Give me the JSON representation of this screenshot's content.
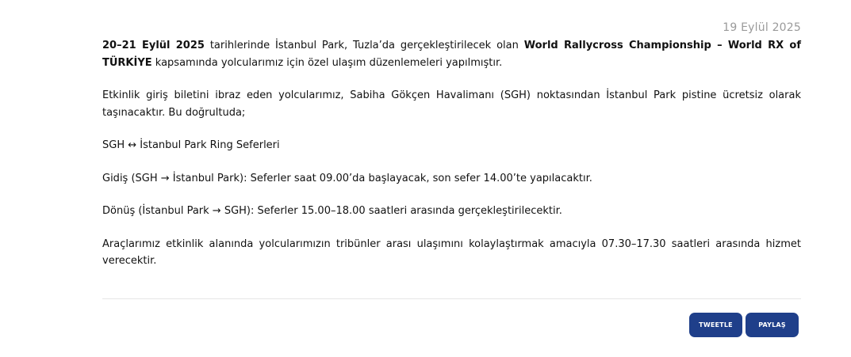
{
  "article": {
    "date": "19 Eylül 2025",
    "p1": {
      "date_range": "20–21 Eylül 2025",
      "text_a": " tarihlerinde İstanbul Park, Tuzla’da gerçekleştirilecek olan ",
      "event_name": "World Rallycross Championship – World RX of TÜRKİYE",
      "text_b": " kapsamında yolcularımız için özel ulaşım düzenlemeleri yapılmıştır."
    },
    "p2": "Etkinlik giriş biletini ibraz eden yolcularımız, Sabiha Gökçen Havalimanı (SGH) noktasından İstanbul Park pistine ücretsiz olarak taşınacaktır. Bu doğrultuda;",
    "p3": "SGH ↔ İstanbul Park Ring Seferleri",
    "p4": "Gidiş (SGH → İstanbul Park): Seferler saat 09.00’da başlayacak, son sefer 14.00’te yapılacaktır.",
    "p5": "Dönüş (İstanbul Park → SGH): Seferler 15.00–18.00 saatleri arasında gerçekleştirilecektir.",
    "p6": "Araçlarımız etkinlik alanında yolcularımızın tribünler arası ulaşımını kolaylaştırmak amacıyla 07.30–17.30 saatleri arasında hizmet verecektir."
  },
  "share": {
    "tweet_label": "TWEETLE",
    "share_label": "PAYLAŞ"
  },
  "colors": {
    "button_bg": "#1f3f8a",
    "date_text": "#9a9a9a",
    "divider": "#e6e6e6"
  }
}
